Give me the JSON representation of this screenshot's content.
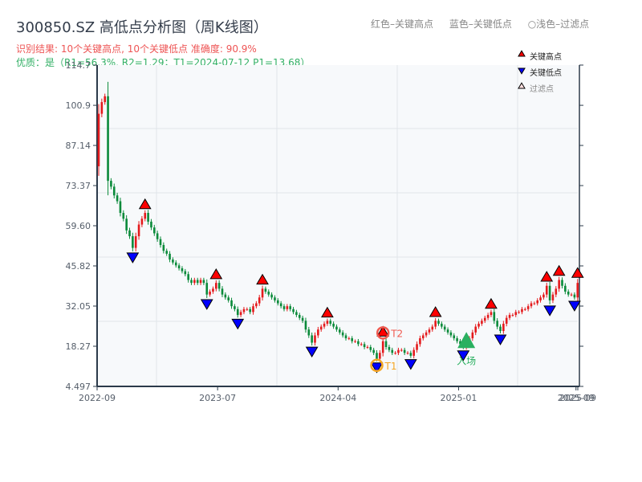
{
  "header": {
    "title": "300850.SZ 高低点分析图（周K线图）",
    "result_line": "识别结果: 10个关键高点, 10个关键低点   准确度: 90.9%",
    "quality_line": "优质：是（R1=56.3%, R2=1.29；T1=2024-07-12 P1=13.68）",
    "legend_red": "红色–关键高点",
    "legend_blue": "蓝色–关键低点",
    "legend_light": "○浅色–过滤点"
  },
  "chart_data": {
    "type": "candlestick",
    "title": "300850.SZ 高低点分析图（周K线图）",
    "ylim": [
      4.497,
      114.7
    ],
    "y_ticks": [
      "114.7",
      "100.9",
      "87.14",
      "73.37",
      "59.60",
      "45.82",
      "32.05",
      "18.27",
      "4.497"
    ],
    "y_tick_values": [
      114.7,
      100.9,
      87.14,
      73.37,
      59.6,
      45.82,
      32.05,
      18.27,
      4.497
    ],
    "x_ticks": [
      {
        "label": "2022-09",
        "i": 0
      },
      {
        "label": "2023-07",
        "i": 39
      },
      {
        "label": "2024-04",
        "i": 78
      },
      {
        "label": "2025-01",
        "i": 117
      },
      {
        "label": "2025-09",
        "i": 155
      },
      {
        "label": "2025-09",
        "i": 156
      }
    ],
    "grid": true,
    "colors": {
      "up": "#e41a1c",
      "down": "#0a8a3a",
      "high_marker": "#ff0000",
      "low_marker": "#0000ff",
      "entry": "#2ab060",
      "t1": "#f5a623",
      "t2": "#f05a50"
    },
    "first_open": 80,
    "closes": [
      98,
      102,
      104,
      75,
      73,
      70,
      68,
      64,
      62,
      58,
      56,
      52,
      56,
      60,
      62,
      64,
      61,
      59,
      57,
      55,
      53,
      51,
      50,
      48,
      47,
      46,
      45,
      44,
      43,
      41,
      40,
      41,
      40,
      41,
      40,
      36,
      37,
      38,
      40,
      38,
      36,
      35,
      34,
      32,
      31,
      29,
      30,
      31,
      31,
      30,
      32,
      33,
      35,
      38,
      37,
      36,
      35,
      34,
      33,
      32,
      31,
      32,
      31,
      30,
      29,
      28,
      27,
      24,
      22,
      19.5,
      22,
      24,
      25,
      26,
      27,
      26,
      25,
      24,
      23,
      22,
      21,
      21,
      20,
      20,
      19,
      19,
      18,
      18,
      17,
      16,
      14,
      16,
      20,
      18,
      17,
      16,
      16,
      17,
      17,
      16,
      16,
      15,
      17,
      19,
      21,
      22,
      23,
      24,
      25,
      27,
      26,
      25,
      24,
      23,
      22,
      21,
      20,
      19,
      18,
      20,
      21,
      23,
      25,
      26,
      27,
      28,
      29,
      30,
      27,
      25,
      23.5,
      26,
      28,
      29,
      29,
      30,
      30,
      31,
      31,
      32,
      33,
      33,
      34,
      35,
      36,
      39,
      34,
      36,
      38,
      41,
      39,
      37,
      36,
      36,
      35,
      40
    ],
    "key_highs": [
      15,
      38,
      53,
      74,
      92,
      109,
      127,
      145,
      149,
      155
    ],
    "key_lows": [
      11,
      35,
      45,
      69,
      90,
      101,
      118,
      130,
      146,
      154
    ],
    "annotations": {
      "t1": {
        "label": "T1",
        "i": 90
      },
      "t2": {
        "label": "T2",
        "i": 92
      },
      "entry": {
        "label": "入场",
        "i": 119
      }
    },
    "legend": {
      "placement": "top-right",
      "items": [
        "关键高点",
        "关键低点",
        "过滤点"
      ]
    }
  }
}
